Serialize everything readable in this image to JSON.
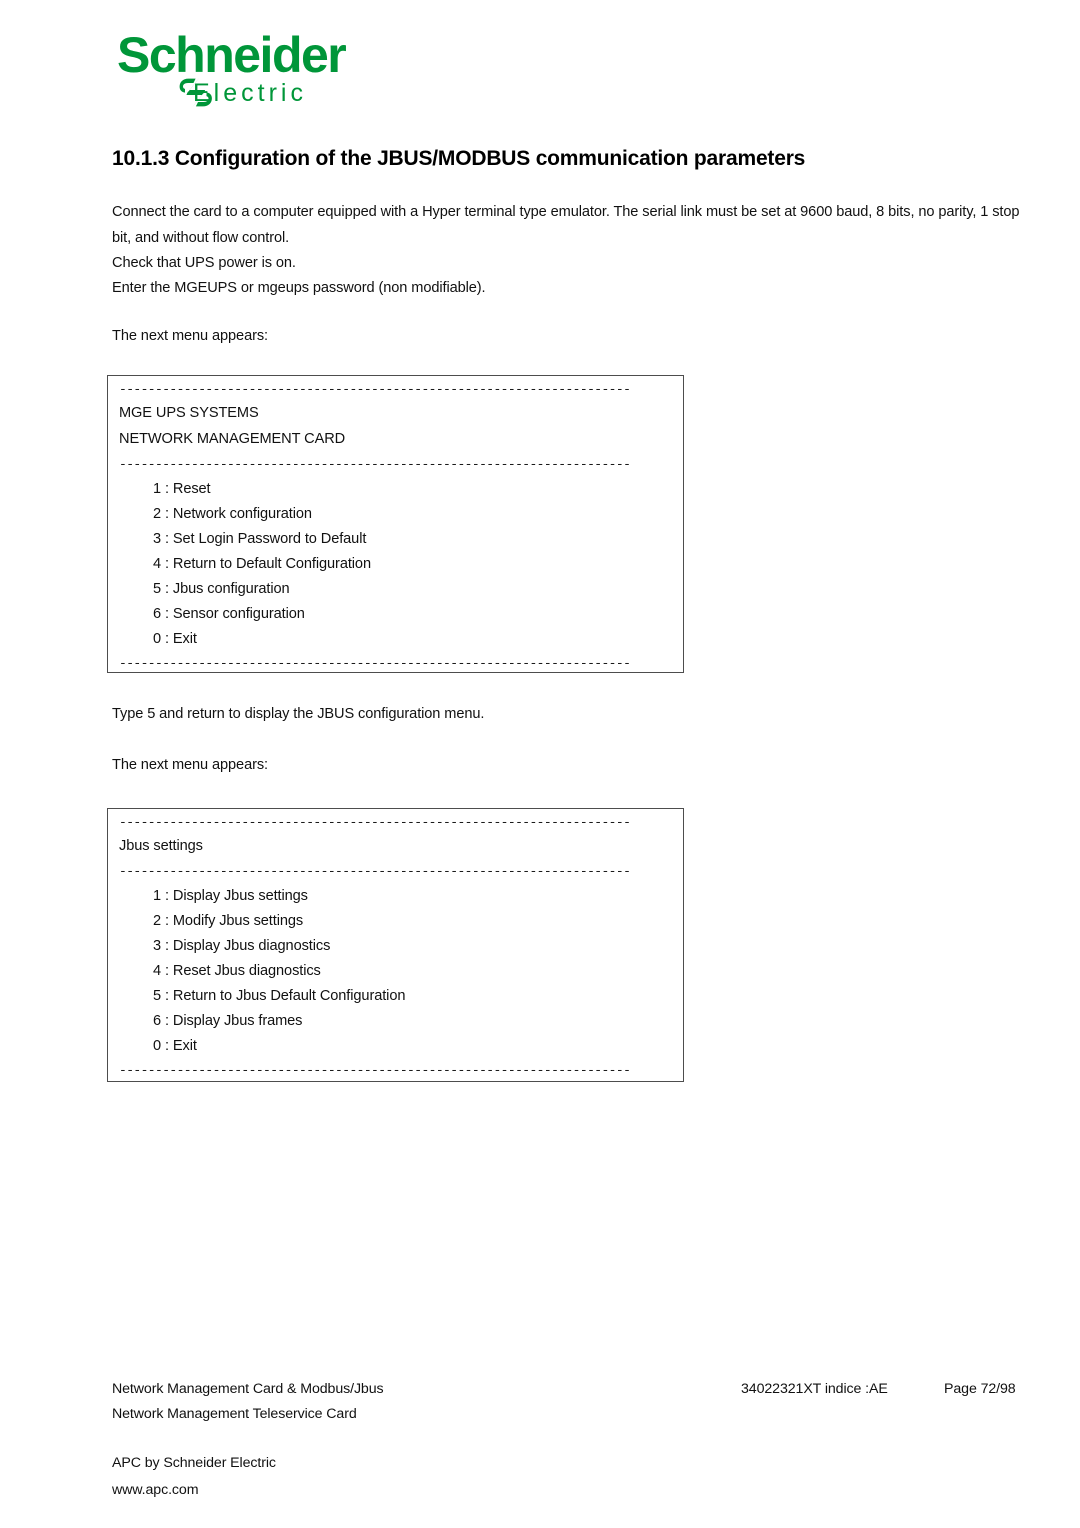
{
  "brand": {
    "name": "Schneider",
    "sub": "Electric",
    "color": "#009639",
    "mark": "lifeline-logo"
  },
  "heading": "10.1.3 Configuration of the JBUS/MODBUS communication parameters",
  "body": {
    "p1": "Connect the card to a computer equipped with a Hyper terminal type emulator. The serial link must be set at 9600 baud, 8 bits, no parity, 1 stop bit, and without flow control.",
    "p2": "Check that UPS power is on.",
    "p3": "Enter the MGEUPS or mgeups password (non modifiable).",
    "p4": "The next menu appears:",
    "p5": "Type 5 and return to display the JBUS configuration menu.",
    "p6": "The next menu appears:"
  },
  "terminal1": {
    "rule": "-----------------------------------------------------------------------",
    "title1": "MGE UPS SYSTEMS",
    "title2": "NETWORK MANAGEMENT CARD",
    "items": [
      "1 : Reset",
      "2 : Network configuration",
      "3 : Set Login Password to Default",
      "4 : Return to Default Configuration",
      "5 : Jbus configuration",
      "6 : Sensor configuration",
      "0 : Exit"
    ]
  },
  "terminal2": {
    "rule": "-----------------------------------------------------------------------",
    "title1": "Jbus settings",
    "items": [
      "1 : Display Jbus settings",
      "2 : Modify Jbus settings",
      "3 : Display Jbus diagnostics",
      "4 : Reset Jbus diagnostics",
      "5 : Return to Jbus Default Configuration",
      "6 : Display Jbus frames",
      "0 : Exit"
    ]
  },
  "footer": {
    "left1": "Network Management Card & Modbus/Jbus",
    "left2": "Network Management Teleservice Card",
    "left3": "APC by Schneider Electric",
    "left4": "www.apc.com",
    "doc_ref": "34022321XT indice :AE",
    "page": "Page 72/98"
  }
}
